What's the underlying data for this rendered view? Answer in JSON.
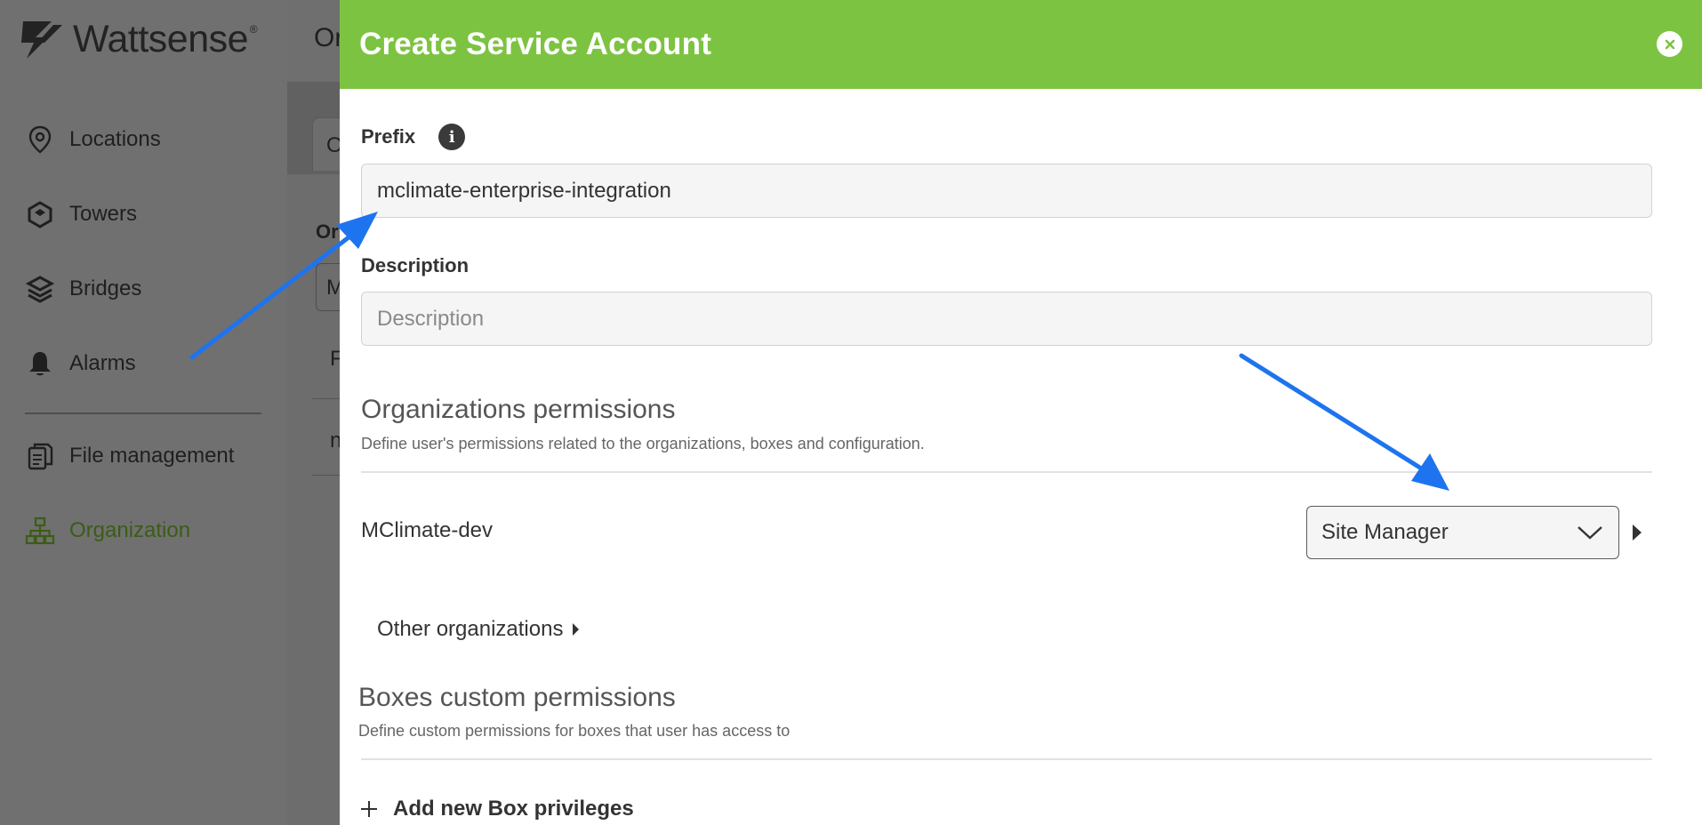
{
  "app": {
    "brand": "Wattsense",
    "brand_mark": "®",
    "nav": [
      {
        "label": "Locations",
        "icon": "location-pin-icon"
      },
      {
        "label": "Towers",
        "icon": "tower-icon"
      },
      {
        "label": "Bridges",
        "icon": "bridge-icon"
      },
      {
        "label": "Alarms",
        "icon": "bell-icon"
      },
      {
        "label": "File management",
        "icon": "files-icon"
      },
      {
        "label": "Organization",
        "icon": "org-chart-icon",
        "active": true
      }
    ],
    "background_fragments": {
      "title": "Or",
      "tab": "O",
      "label": "Or",
      "input": "M",
      "row1": "F",
      "row2": "n"
    }
  },
  "modal": {
    "title": "Create Service Account",
    "close_icon": "close-icon",
    "prefix": {
      "label": "Prefix",
      "value": "mclimate-enterprise-integration"
    },
    "description": {
      "label": "Description",
      "placeholder": "Description",
      "value": ""
    },
    "org_permissions": {
      "title": "Organizations permissions",
      "subtitle": "Define user's permissions related to the organizations, boxes and configuration.",
      "org_name": "MClimate-dev",
      "role": "Site Manager",
      "other_label": "Other organizations"
    },
    "box_permissions": {
      "title": "Boxes custom permissions",
      "subtitle": "Define custom permissions for boxes that user has access to",
      "add_label": "Add new Box privileges"
    }
  },
  "colors": {
    "header_green": "#7dc342",
    "active_nav": "#3c5c16",
    "arrow_blue": "#1e74ee",
    "overlay_gray": "#6e6e6e"
  }
}
